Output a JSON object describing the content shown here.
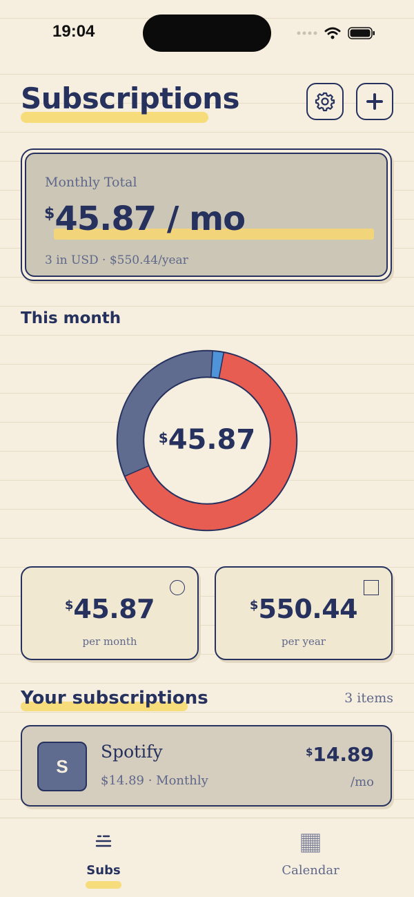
{
  "status_bar": {
    "time": "19:04"
  },
  "header": {
    "title": "Subscriptions"
  },
  "total_card": {
    "label": "Monthly Total",
    "currency_symbol": "$",
    "amount": "45.87 / mo",
    "summary": "3 in USD · $550.44/year"
  },
  "this_month": {
    "title": "This month",
    "center_currency": "$",
    "center_value": "45.87",
    "segments": [
      {
        "color": "#e85d52",
        "fraction": 0.655
      },
      {
        "color": "#5f6b8f",
        "fraction": 0.325
      },
      {
        "color": "#4f93d8",
        "fraction": 0.02
      }
    ]
  },
  "stats": {
    "month": {
      "currency": "$",
      "value": "45.87",
      "label": "per month"
    },
    "year": {
      "currency": "$",
      "value": "550.44",
      "label": "per year"
    }
  },
  "subscriptions": {
    "title": "Your subscriptions",
    "count": "3 items",
    "items": [
      {
        "initial": "S",
        "name": "Spotify",
        "meta": "$14.89 · Monthly",
        "currency": "$",
        "price": "14.89",
        "unit": "/mo"
      }
    ]
  },
  "tabs": [
    {
      "label": "Subs",
      "icon": "list-icon",
      "active": true
    },
    {
      "label": "Calendar",
      "icon": "calendar-grid-icon",
      "active": false
    }
  ],
  "colors": {
    "ink": "#26315e",
    "highlight": "#f7dc7c",
    "paper": "#f6efdf"
  }
}
